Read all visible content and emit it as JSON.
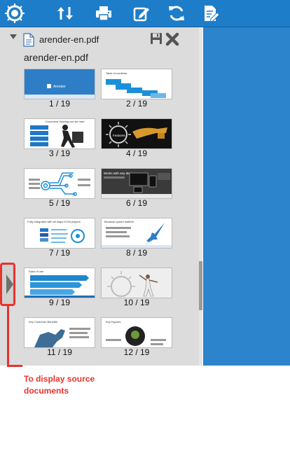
{
  "toolbar": {
    "icons": [
      "logo-gear-icon",
      "sort-arrows-icon",
      "printer-icon",
      "edit-icon",
      "refresh-icon",
      "document-edit-icon"
    ]
  },
  "colors": {
    "toolbar": "#1e7dc9",
    "viewer": "#2c84cc",
    "panel": "#dcdcdc",
    "annotation": "#e8322c"
  },
  "panel": {
    "document": {
      "file_name": "arender-en.pdf",
      "title": "arender-en.pdf",
      "icons": [
        "pdf-icon",
        "save-icon",
        "close-icon"
      ]
    },
    "thumbnails": [
      {
        "label": "1 / 19",
        "caption": "Arender"
      },
      {
        "label": "2 / 19",
        "caption": "Table of contents"
      },
      {
        "label": "3 / 19",
        "caption": "Document Viewing can be hard"
      },
      {
        "label": "4 / 19",
        "caption": "Features"
      },
      {
        "label": "5 / 19",
        "caption": ""
      },
      {
        "label": "6 / 19",
        "caption": "Works with any device"
      },
      {
        "label": "7 / 19",
        "caption": "Fully integrated with all major ECM players"
      },
      {
        "label": "8 / 19",
        "caption": "Because speed matters"
      },
      {
        "label": "9 / 19",
        "caption": "Ease of use"
      },
      {
        "label": "10 / 19",
        "caption": ""
      },
      {
        "label": "11 / 19",
        "caption": "Key Customer Benefits"
      },
      {
        "label": "12 / 19",
        "caption": "Key Figures"
      }
    ]
  },
  "annotation": {
    "text": "To display source documents"
  }
}
